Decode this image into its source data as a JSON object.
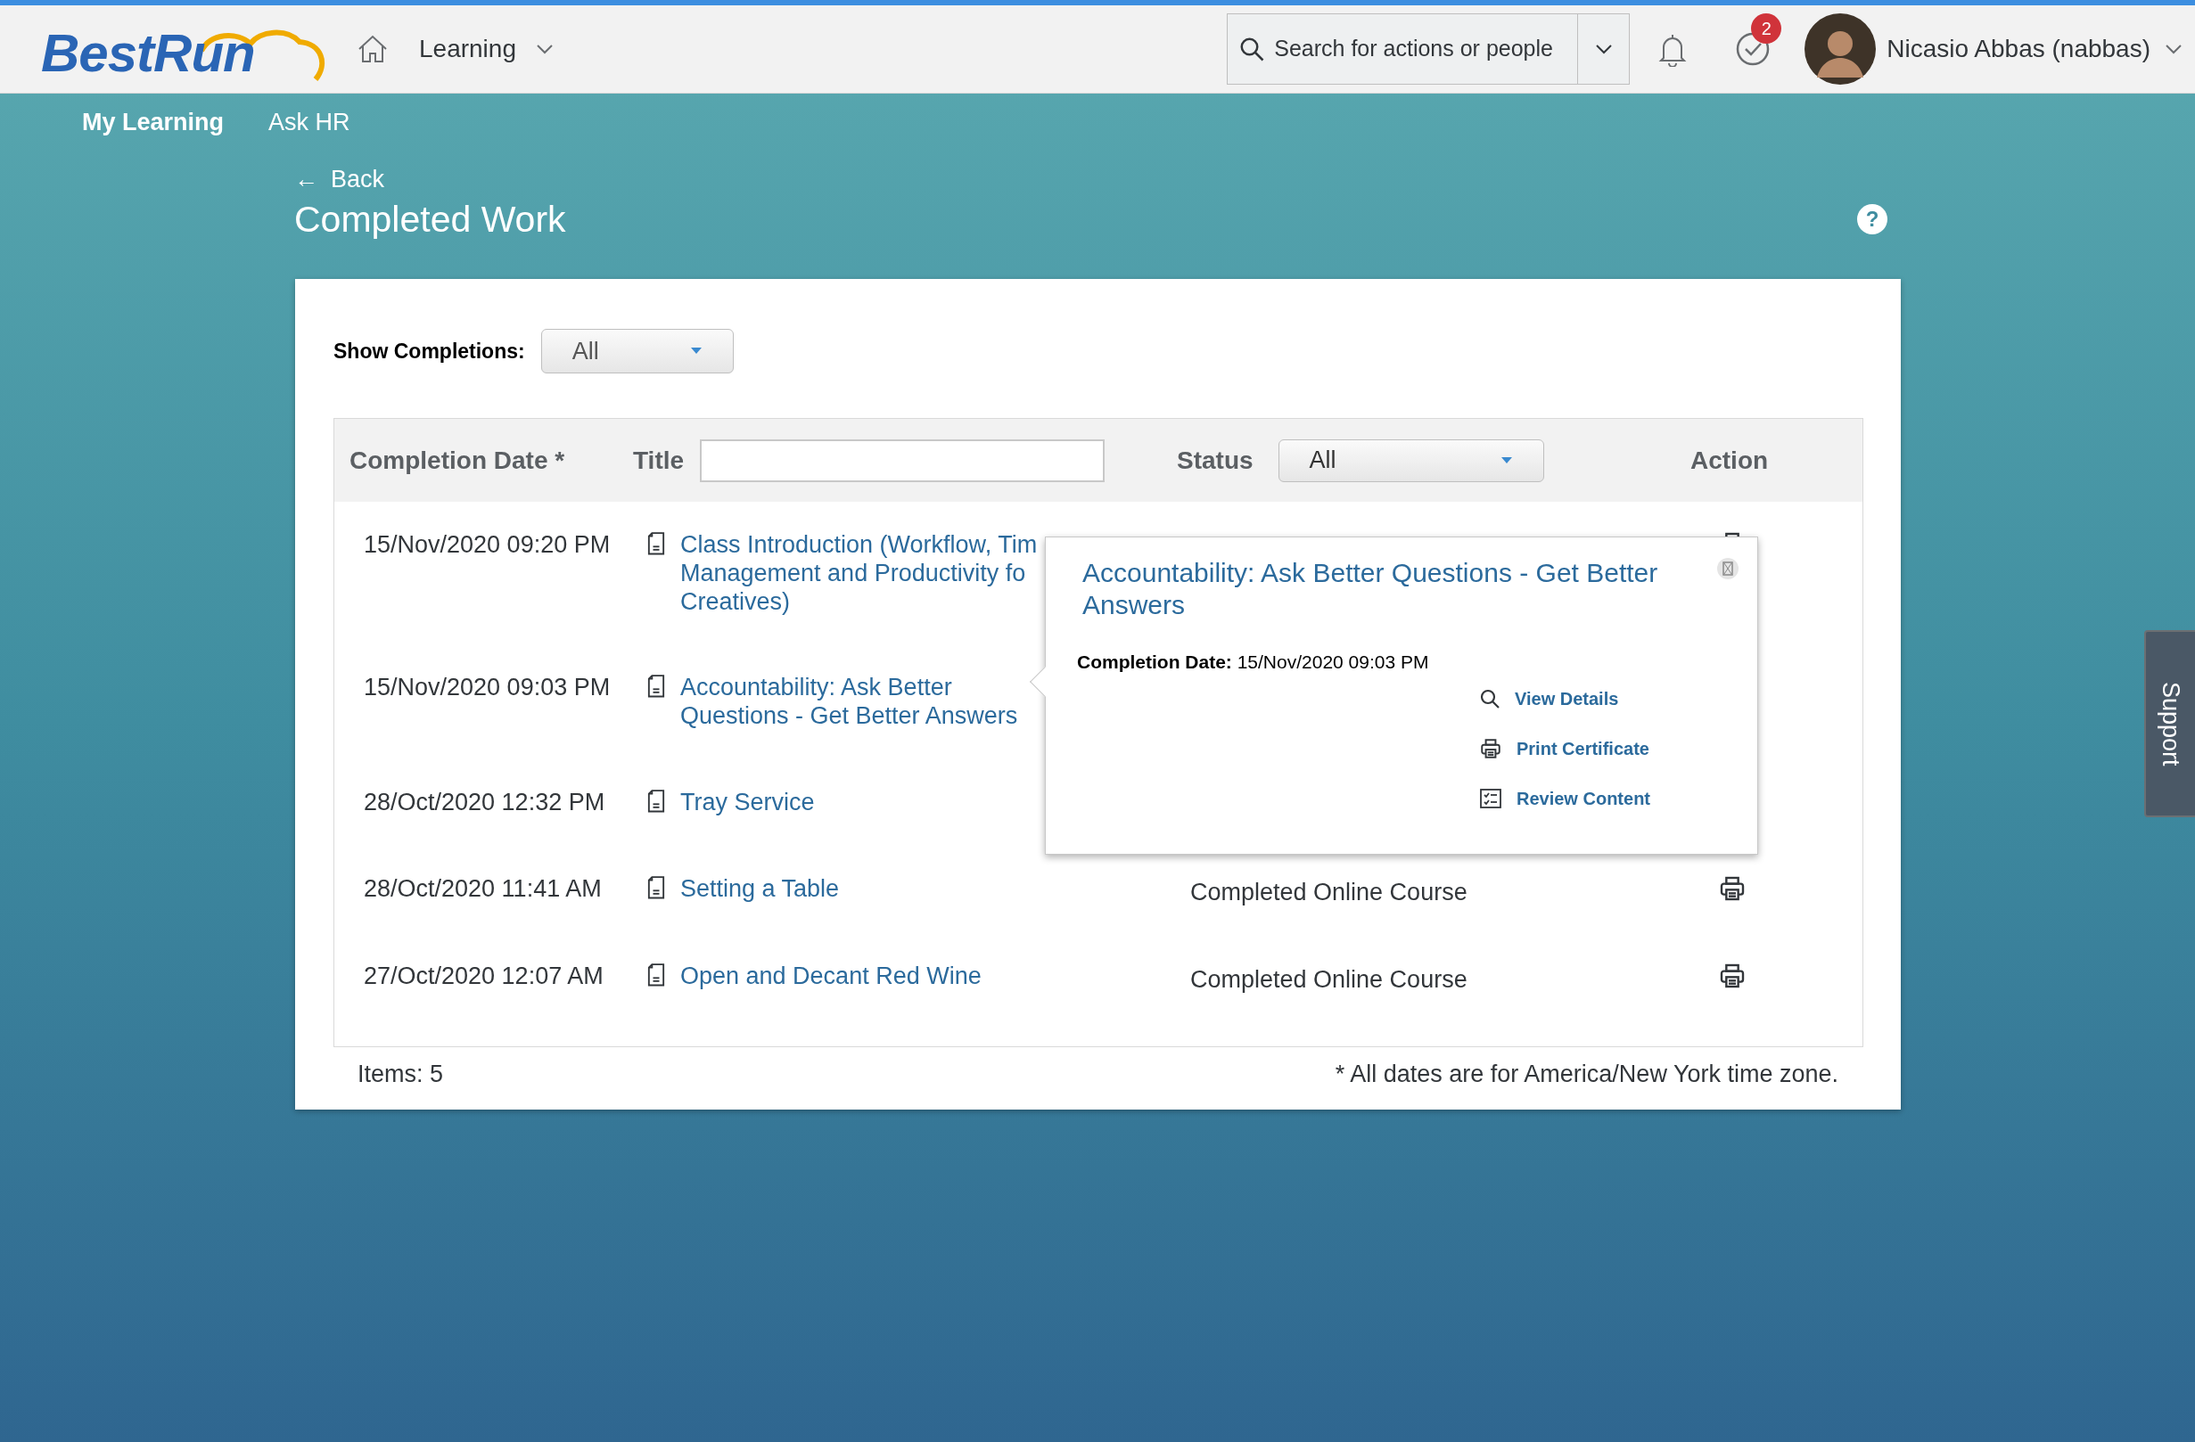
{
  "header": {
    "logo": "BestRun",
    "nav_menu": "Learning",
    "search": {
      "placeholder": "Search for actions or people"
    },
    "todo_badge": "2",
    "user": "Nicasio Abbas (nabbas)"
  },
  "subnav": [
    {
      "label": "My Learning",
      "selected": true
    },
    {
      "label": "Ask HR",
      "selected": false
    }
  ],
  "back": {
    "arrow": "←",
    "label": "Back"
  },
  "page_title": "Completed Work",
  "help": "?",
  "filter": {
    "label": "Show Completions:",
    "value": "All"
  },
  "table": {
    "columns": [
      {
        "label": "Completion Date *",
        "kind": "plain"
      },
      {
        "label": "Title",
        "kind": "search"
      },
      {
        "label": "Status",
        "kind": "select",
        "value": "All"
      },
      {
        "label": "Action",
        "kind": "plain"
      }
    ],
    "rows": [
      {
        "date": "15/Nov/2020 09:20 PM",
        "title_lines": [
          "Class Introduction (Workflow, Tim",
          "Management and Productivity fo",
          "Creatives)"
        ],
        "kind": "printable"
      },
      {
        "date": "15/Nov/2020 09:03 PM",
        "title_lines": [
          "Accountability: Ask Better",
          "Questions - Get Better Answers"
        ],
        "kind": "covered"
      },
      {
        "date": "28/Oct/2020 12:32 PM",
        "title_lines": [
          "Tray Service"
        ],
        "kind": "covered"
      },
      {
        "date": "28/Oct/2020 11:41 AM",
        "title_lines": [
          "Setting a Table"
        ],
        "status": "Completed Online Course",
        "kind": "printable"
      },
      {
        "date": "27/Oct/2020 12:07 AM",
        "title_lines": [
          "Open and Decant Red Wine"
        ],
        "status": "Completed Online Course",
        "kind": "printable"
      }
    ]
  },
  "footer": {
    "count": "Items: 5",
    "note": "* All dates are for America/New York time zone."
  },
  "popup": {
    "title": "Accountability: Ask Better Questions - Get Better Answers",
    "date_label": "Completion Date:",
    "date": "15/Nov/2020 09:03 PM",
    "actions": [
      {
        "label": "View Details",
        "kind": "search"
      },
      {
        "label": "Print Certificate",
        "kind": "print"
      },
      {
        "label": "Review Content",
        "kind": "checklist"
      }
    ]
  },
  "support": "Support"
}
